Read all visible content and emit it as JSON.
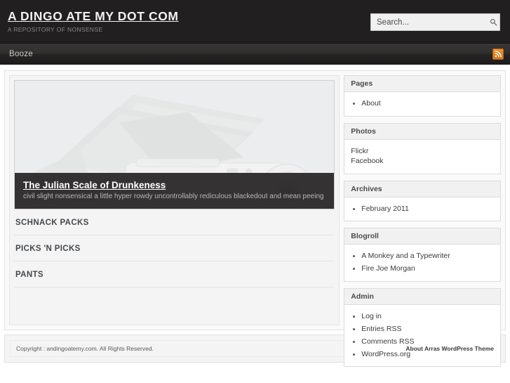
{
  "header": {
    "site_title": "A DINGO ATE MY DOT COM",
    "tagline": "A REPOSITORY OF NONSENSE",
    "search_placeholder": "Search...",
    "search_value": "",
    "search_icon": "magnifier-icon"
  },
  "nav": {
    "items": [
      {
        "label": "Booze",
        "active": true
      }
    ],
    "rss_icon": "rss-icon",
    "rss_label": "RSS"
  },
  "featured": {
    "title": "The Julian Scale of Drunkeness",
    "excerpt": "civil slight nonsensical a little hyper rowdy uncontrollably rediculous blackedout and mean peeing on your couch",
    "image_alt": "camera-and-photos-placeholder"
  },
  "posts": [
    {
      "title": "SCHNACK PACKS"
    },
    {
      "title": "PICKS 'N PICKS"
    },
    {
      "title": "PANTS"
    }
  ],
  "sidebar": {
    "widgets": [
      {
        "title": "Pages",
        "style": "bulleted",
        "items": [
          {
            "label": "About"
          }
        ]
      },
      {
        "title": "Photos",
        "style": "plain",
        "items": [
          {
            "label": "Flickr"
          },
          {
            "label": "Facebook"
          }
        ]
      },
      {
        "title": "Archives",
        "style": "bulleted",
        "items": [
          {
            "label": "February 2011"
          }
        ]
      },
      {
        "title": "Blogroll",
        "style": "bulleted",
        "items": [
          {
            "label": "A Monkey and a Typewriter"
          },
          {
            "label": "Fire Joe Morgan"
          }
        ]
      },
      {
        "title": "Admin",
        "style": "bulleted",
        "items": [
          {
            "label": "Log in"
          },
          {
            "label": "Entries RSS"
          },
          {
            "label": "Comments RSS"
          },
          {
            "label": "WordPress.org"
          }
        ]
      }
    ]
  },
  "footer": {
    "copyright": "Copyright : andingoatemy.com. All Rights Reserved.",
    "credit": "About Arras WordPress Theme"
  },
  "colors": {
    "header_bg": "#211F1F",
    "nav_bg": "#312E2E",
    "rss_orange": "#D2751A",
    "caption_bg": "#262424",
    "page_bg": "#FFFFFF",
    "panel_bg": "#F4F4F4"
  }
}
